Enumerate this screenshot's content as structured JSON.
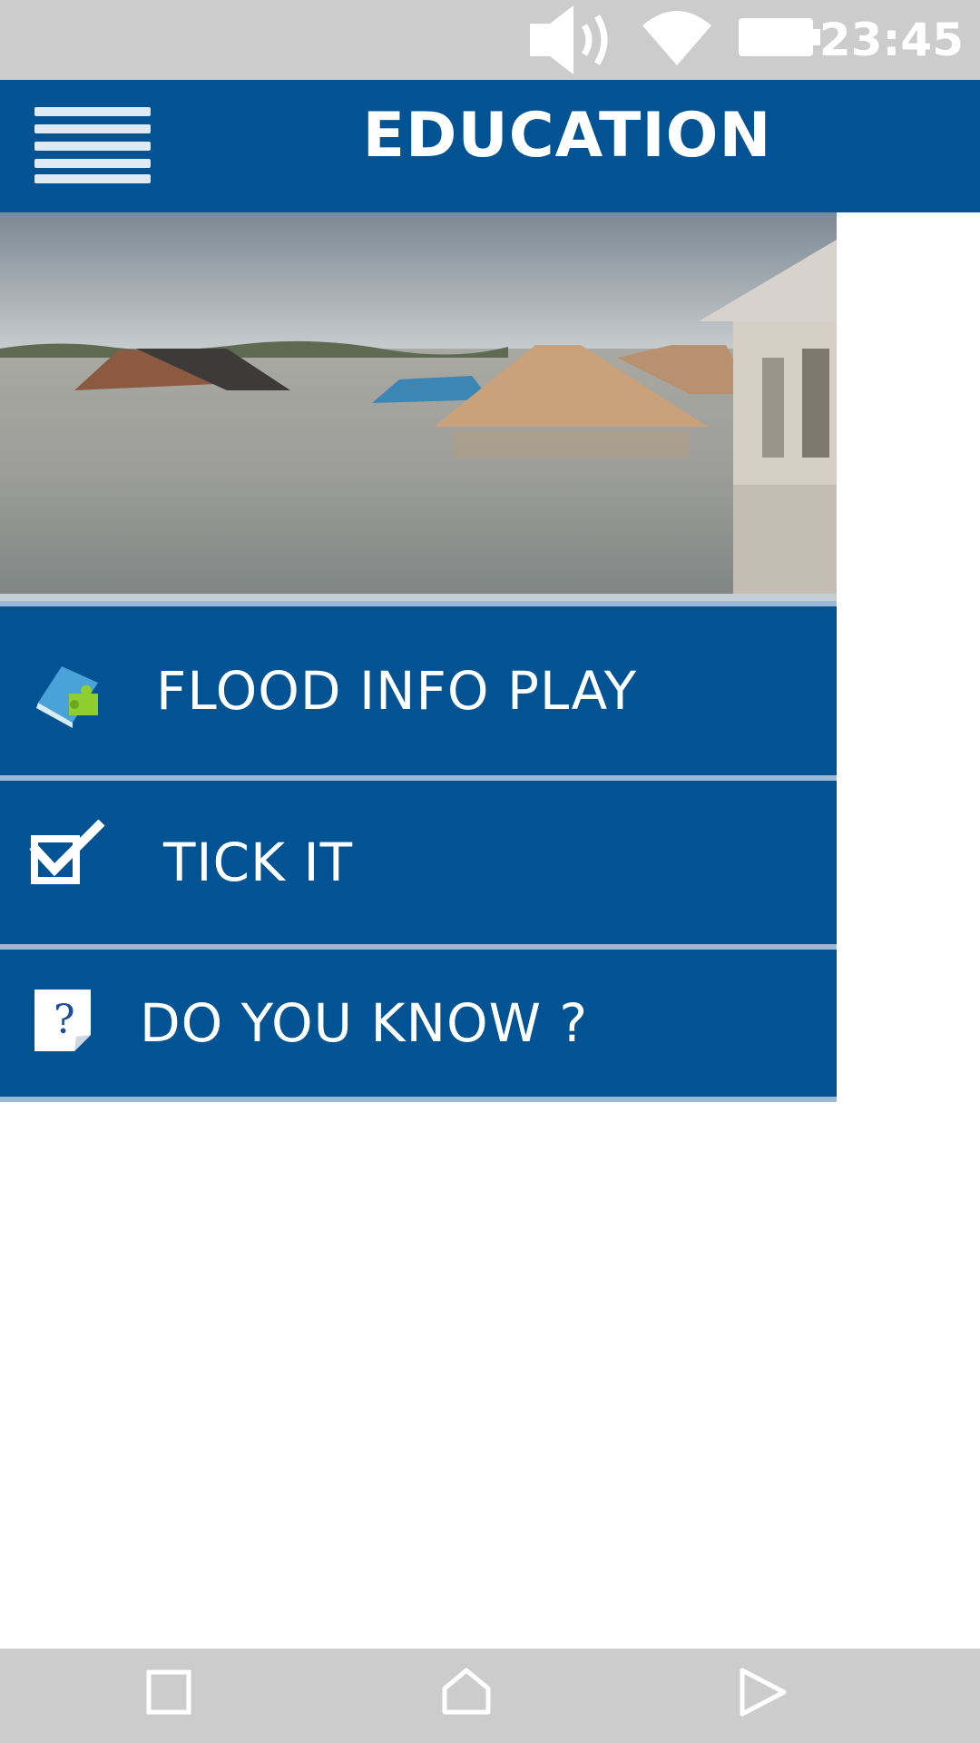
{
  "status_bar": {
    "time": "23:45",
    "icons": [
      "volume-icon",
      "wifi-icon",
      "battery-icon"
    ]
  },
  "app_bar": {
    "title": "EDUCATION",
    "menu_icon": "hamburger-menu-icon"
  },
  "drawer": {
    "header_image": "flooded-houses-photo",
    "items": [
      {
        "label": "FLOOD INFO PLAY",
        "icon": "puzzle-book-icon"
      },
      {
        "label": "TICK IT",
        "icon": "checkbox-tick-icon"
      },
      {
        "label": "DO YOU KNOW ?",
        "icon": "question-note-icon"
      }
    ]
  },
  "nav_bar": {
    "icons": [
      "recents-square-icon",
      "home-icon",
      "back-triangle-icon"
    ]
  },
  "colors": {
    "primary": "#025394",
    "divider": "#9cb8d3",
    "system_bar": "#cccccc"
  }
}
